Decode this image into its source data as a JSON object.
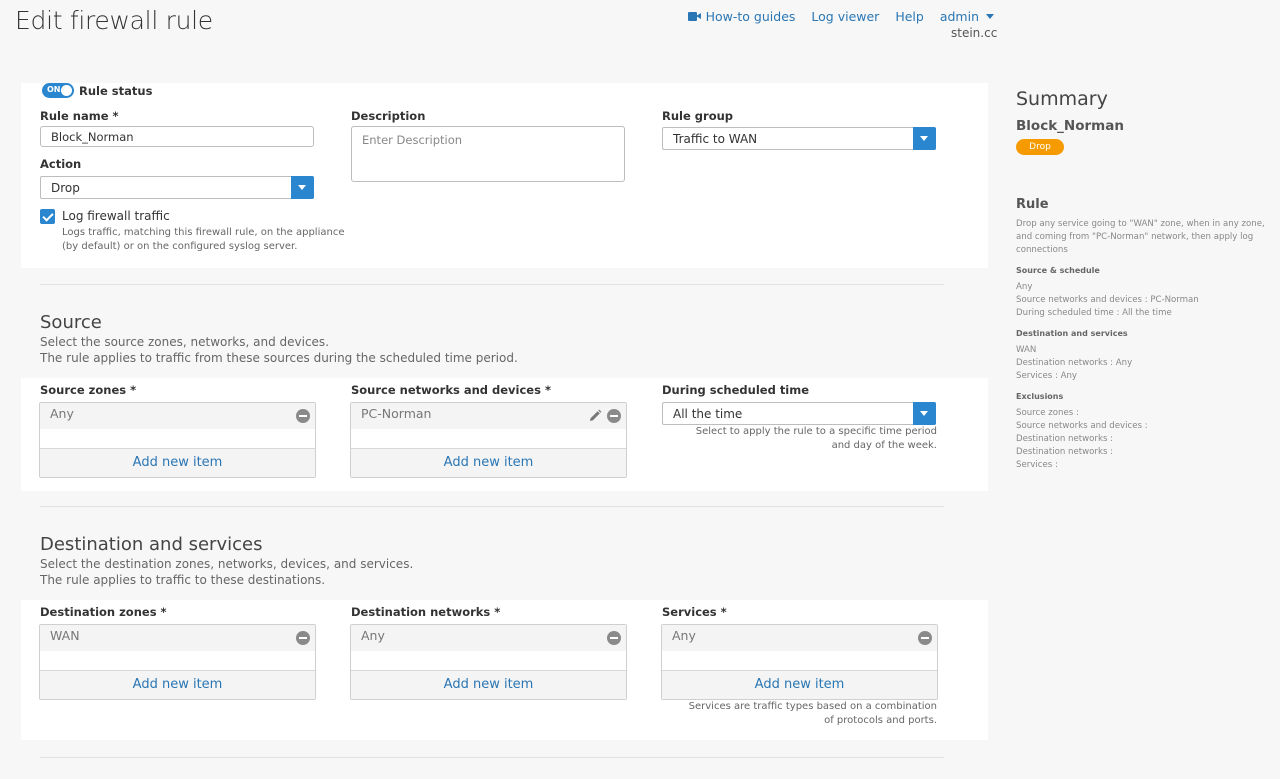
{
  "header": {
    "title": "Edit firewall rule",
    "nav": {
      "how_to": "How-to guides",
      "log_viewer": "Log viewer",
      "help": "Help",
      "user": "admin",
      "domain": "stein.cc"
    }
  },
  "rule": {
    "status_on_text": "ON",
    "status_label": "Rule status",
    "name_label": "Rule name *",
    "name_value": "Block_Norman",
    "description_label": "Description",
    "description_placeholder": "Enter Description",
    "group_label": "Rule group",
    "group_value": "Traffic to WAN",
    "action_label": "Action",
    "action_value": "Drop",
    "log_label": "Log firewall traffic",
    "log_help": "Logs traffic, matching this firewall rule, on the appliance (by default) or on the configured syslog server.",
    "log_checked": true,
    "status_on": true
  },
  "source": {
    "title": "Source",
    "desc1": "Select the source zones, networks, and devices.",
    "desc2": "The rule applies to traffic from these sources during the scheduled time period.",
    "zones_label": "Source zones *",
    "zones_item": "Any",
    "networks_label": "Source networks and devices *",
    "networks_item": "PC-Norman",
    "schedule_label": "During scheduled time",
    "schedule_value": "All the time",
    "schedule_help": "Select to apply the rule to a specific time period and day of the week.",
    "add_item": "Add new item"
  },
  "destination": {
    "title": "Destination and services",
    "desc1": "Select the destination zones, networks, devices, and services.",
    "desc2": "The rule applies to traffic to these destinations.",
    "zones_label": "Destination zones *",
    "zones_item": "WAN",
    "networks_label": "Destination networks *",
    "networks_item": "Any",
    "services_label": "Services *",
    "services_item": "Any",
    "services_help": "Services are traffic types based on a combination of protocols and ports.",
    "add_item": "Add new item"
  },
  "summary": {
    "title": "Summary",
    "rule_name": "Block_Norman",
    "badge": "Drop",
    "badge_color": "#f59b00",
    "rule_heading": "Rule",
    "rule_text": "Drop any service going to \"WAN\" zone, when in any zone, and coming from \"PC-Norman\" network, then apply log connections",
    "src_heading": "Source & schedule",
    "src_lines": [
      "Any",
      "Source networks and devices : PC-Norman",
      "During scheduled time : All the time"
    ],
    "dst_heading": "Destination and services",
    "dst_lines": [
      "WAN",
      "Destination networks : Any",
      "Services : Any"
    ],
    "exc_heading": "Exclusions",
    "exc_lines": [
      "Source zones :",
      "Source networks and devices :",
      "Destination networks :",
      "Destination networks :",
      "Services :"
    ]
  },
  "colors": {
    "accent": "#2a87cf",
    "link": "#2a76b4"
  }
}
